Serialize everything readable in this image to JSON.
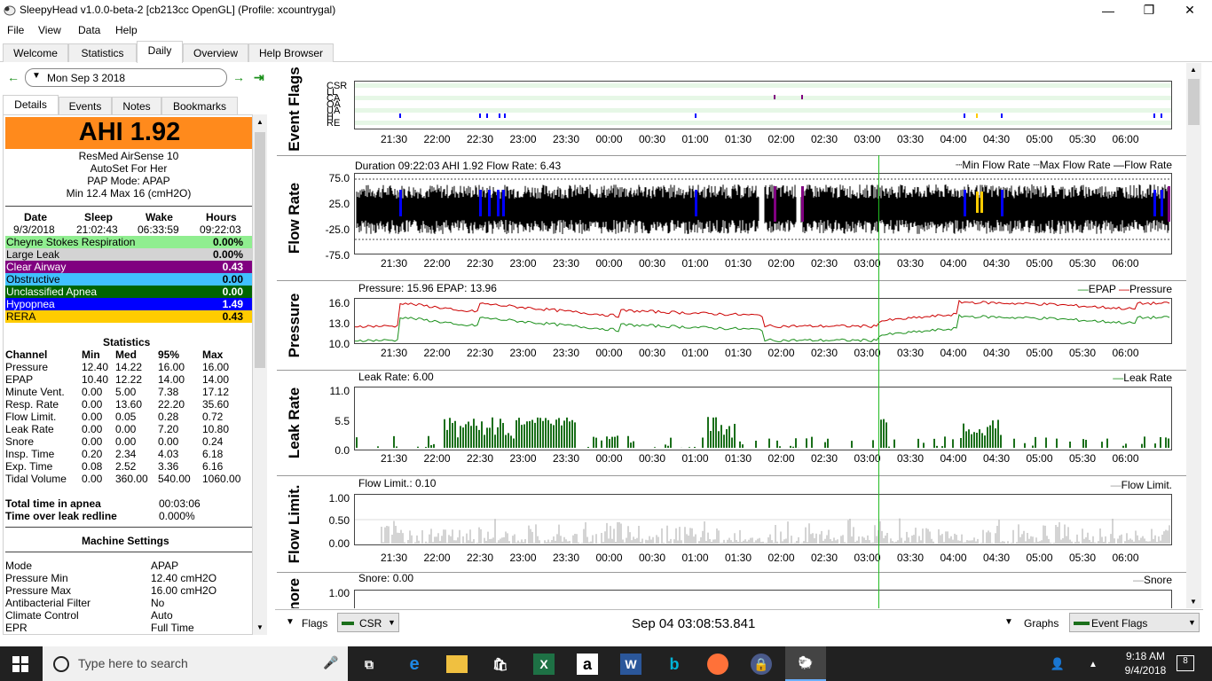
{
  "window": {
    "title": "SleepyHead v1.0.0-beta-2 [cb213cc OpenGL] (Profile: xcountrygal)",
    "minimize": "—",
    "maximize": "❐",
    "close": "✕"
  },
  "menu": [
    "File",
    "View",
    "Data",
    "Help"
  ],
  "tabs": [
    "Welcome",
    "Statistics",
    "Daily",
    "Overview",
    "Help Browser"
  ],
  "active_tab": "Daily",
  "date_nav": {
    "date": "Mon Sep 3 2018",
    "prev": "←",
    "next": "→",
    "last": "⇥"
  },
  "subtabs": [
    "Details",
    "Events",
    "Notes",
    "Bookmarks"
  ],
  "ahi_label": "AHI 1.92",
  "machine_info": [
    "ResMed AirSense 10",
    "AutoSet For Her",
    "PAP Mode: APAP",
    "Min 12.4 Max 16 (cmH2O)"
  ],
  "sleep": {
    "headers": [
      "Date",
      "Sleep",
      "Wake",
      "Hours"
    ],
    "values": [
      "9/3/2018",
      "21:02:43",
      "06:33:59",
      "09:22:03"
    ]
  },
  "events": [
    {
      "name": "Cheyne Stokes Respiration",
      "value": "0.00%",
      "bg": "#90ee90",
      "fg": "#000"
    },
    {
      "name": "Large Leak",
      "value": "0.00%",
      "bg": "#d3d3d3",
      "fg": "#000"
    },
    {
      "name": "Clear Airway",
      "value": "0.43",
      "bg": "#800080",
      "fg": "#fff"
    },
    {
      "name": "Obstructive",
      "value": "0.00",
      "bg": "#40c0ff",
      "fg": "#000"
    },
    {
      "name": "Unclassified Apnea",
      "value": "0.00",
      "bg": "#006400",
      "fg": "#fff"
    },
    {
      "name": "Hypopnea",
      "value": "1.49",
      "bg": "#0000ff",
      "fg": "#fff"
    },
    {
      "name": "RERA",
      "value": "0.43",
      "bg": "#ffcc00",
      "fg": "#000"
    }
  ],
  "statistics": {
    "title": "Statistics",
    "headers": [
      "Channel",
      "Min",
      "Med",
      "95%",
      "Max"
    ],
    "rows": [
      [
        "Pressure",
        "12.40",
        "14.22",
        "16.00",
        "16.00"
      ],
      [
        "EPAP",
        "10.40",
        "12.22",
        "14.00",
        "14.00"
      ],
      [
        "Minute Vent.",
        "0.00",
        "5.00",
        "7.38",
        "17.12"
      ],
      [
        "Resp. Rate",
        "0.00",
        "13.60",
        "22.20",
        "35.60"
      ],
      [
        "Flow Limit.",
        "0.00",
        "0.05",
        "0.28",
        "0.72"
      ],
      [
        "Leak Rate",
        "0.00",
        "0.00",
        "7.20",
        "10.80"
      ],
      [
        "Snore",
        "0.00",
        "0.00",
        "0.00",
        "0.24"
      ],
      [
        "Insp. Time",
        "0.20",
        "2.34",
        "4.03",
        "6.18"
      ],
      [
        "Exp. Time",
        "0.08",
        "2.52",
        "3.36",
        "6.16"
      ],
      [
        "Tidal Volume",
        "0.00",
        "360.00",
        "540.00",
        "1060.00"
      ]
    ]
  },
  "totals": [
    {
      "label": "Total time in apnea",
      "value": "00:03:06"
    },
    {
      "label": "Time over leak redline",
      "value": "0.000%"
    }
  ],
  "machine_settings": {
    "title": "Machine Settings",
    "rows": [
      [
        "Mode",
        "APAP"
      ],
      [
        "Pressure Min",
        "12.40 cmH2O"
      ],
      [
        "Pressure Max",
        "16.00 cmH2O"
      ],
      [
        "Antibacterial Filter",
        "No"
      ],
      [
        "Climate Control",
        "Auto"
      ],
      [
        "EPR",
        "Full Time"
      ]
    ]
  },
  "time_ticks": [
    "21:30",
    "22:00",
    "22:30",
    "23:00",
    "23:30",
    "00:00",
    "00:30",
    "01:00",
    "01:30",
    "02:00",
    "02:30",
    "03:00",
    "03:30",
    "04:00",
    "04:30",
    "05:00",
    "05:30",
    "06:00"
  ],
  "graphs": {
    "event_flags": {
      "title": "Event Flags",
      "labels": [
        "CSR",
        "LL",
        "CA",
        "OA",
        "UA",
        "H",
        "RE"
      ]
    },
    "flow_rate": {
      "title": "Flow Rate",
      "info": "Duration 09:22:03 AHI 1.92 Flow Rate: 6.43",
      "legend": "┈Min Flow Rate ┈Max Flow Rate —Flow Rate",
      "yticks": [
        "75.0",
        "25.0",
        "-25.0",
        "-75.0"
      ]
    },
    "pressure": {
      "title": "Pressure",
      "info": "Pressure: 15.96 EPAP: 13.96",
      "legend_epap": "EPAP",
      "legend_pressure": "Pressure",
      "yticks": [
        "16.0",
        "13.0",
        "10.0"
      ],
      "epap_color": "#1a8f1a",
      "pressure_color": "#cc0000"
    },
    "leak_rate": {
      "title": "Leak Rate",
      "info": "Leak Rate: 6.00",
      "legend": "Leak Rate",
      "yticks": [
        "11.0",
        "5.5",
        "0.0"
      ]
    },
    "flow_limit": {
      "title": "Flow Limit.",
      "info": "Flow Limit.: 0.10",
      "legend": "Flow Limit.",
      "yticks": [
        "1.00",
        "0.50",
        "0.00"
      ]
    },
    "snore": {
      "title": "Snore",
      "info": "Snore: 0.00",
      "legend": "Snore",
      "yticks": [
        "1.00"
      ]
    }
  },
  "bottom": {
    "flags_label": "Flags",
    "flags_select": "CSR",
    "timestamp": "Sep 04 03:08:53.841",
    "graphs_label": "Graphs",
    "graphs_select": "Event Flags"
  },
  "taskbar": {
    "search_placeholder": "Type here to search",
    "time": "9:18 AM",
    "date": "9/4/2018",
    "notif_count": "8"
  }
}
